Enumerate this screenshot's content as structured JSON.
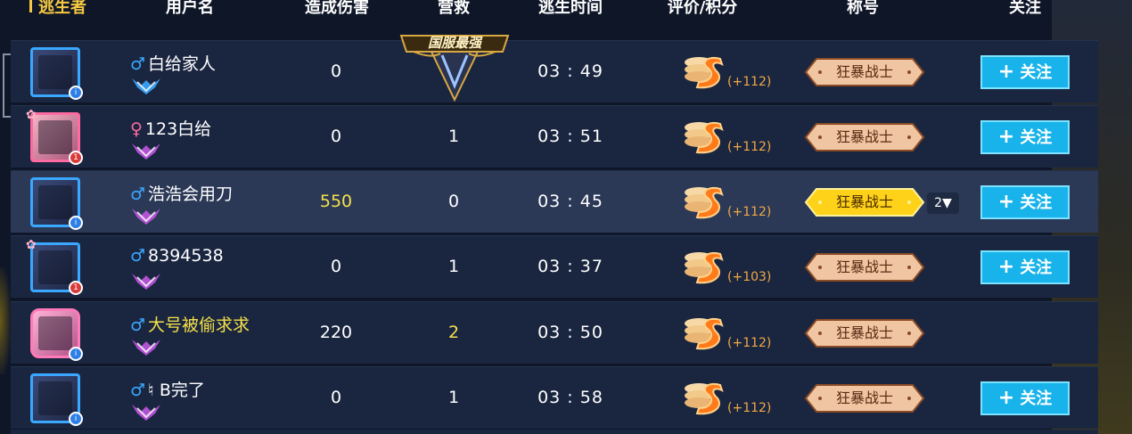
{
  "columns": [
    {
      "label": "逃生者",
      "active": true
    },
    {
      "label": "用户名"
    },
    {
      "label": "造成伤害"
    },
    {
      "label": "营救"
    },
    {
      "label": "逃生时间"
    },
    {
      "label": "评价/积分"
    },
    {
      "label": "称号"
    },
    {
      "label": "关注"
    }
  ],
  "mvp_badge": "国服最强",
  "follow_label": "关注",
  "rows": [
    {
      "gender": "♂",
      "gender_type": "male",
      "name": "白给家人",
      "name_color": "white",
      "damage": "0",
      "rescue": "",
      "time": "03 : 49",
      "score": "(+112)",
      "title": "狂暴战士",
      "title_style": "bronze",
      "follow": true,
      "rank_color": "#3aa8ff",
      "avatar_badge": "i",
      "mvp": true
    },
    {
      "gender": "♀",
      "gender_type": "female",
      "name": "123白给",
      "name_color": "white",
      "damage": "0",
      "rescue": "1",
      "time": "03 : 51",
      "score": "(+112)",
      "title": "狂暴战士",
      "title_style": "bronze",
      "follow": true,
      "rank_color": "#c055e0",
      "avatar_badge": "1"
    },
    {
      "gender": "♂",
      "gender_type": "male",
      "name": "浩浩会用刀",
      "name_color": "white",
      "damage": "550",
      "damage_gold": true,
      "rescue": "0",
      "time": "03 : 45",
      "score": "(+112)",
      "title": "狂暴战士",
      "title_style": "gold",
      "follow": true,
      "rank_color": "#c055e0",
      "avatar_badge": "i",
      "dropdown": "2▼",
      "highlight": true
    },
    {
      "gender": "♂",
      "gender_type": "male",
      "name": "8394538",
      "name_color": "white",
      "damage": "0",
      "rescue": "1",
      "time": "03 : 37",
      "score": "(+103)",
      "title": "狂暴战士",
      "title_style": "bronze",
      "follow": true,
      "rank_color": "#c055e0",
      "avatar_badge": "1"
    },
    {
      "gender": "♂",
      "gender_type": "male",
      "name": "大号被偷求求",
      "name_color": "gold",
      "damage": "220",
      "rescue": "2",
      "rescue_gold": true,
      "time": "03 : 50",
      "score": "(+112)",
      "title": "狂暴战士",
      "title_style": "bronze",
      "follow": false,
      "rank_color": "#c055e0",
      "avatar_badge": "i"
    },
    {
      "gender": "♂",
      "gender_type": "male",
      "name": "♮ B完了",
      "name_color": "white",
      "damage": "0",
      "rescue": "1",
      "time": "03 : 58",
      "score": "(+112)",
      "title": "狂暴战士",
      "title_style": "bronze",
      "follow": true,
      "rank_color": "#c055e0",
      "avatar_badge": "i"
    }
  ]
}
